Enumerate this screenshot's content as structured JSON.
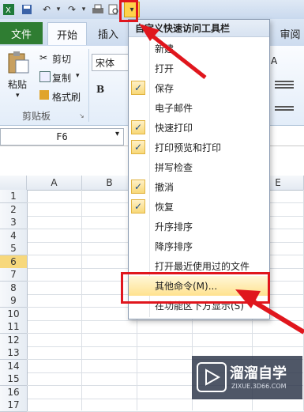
{
  "quick_access": {
    "dropdown_glyph": "▾"
  },
  "tabs": {
    "file": "文件",
    "home": "开始",
    "insert": "插入",
    "review": "审阅"
  },
  "ribbon": {
    "paste": "粘贴",
    "cut": "剪切",
    "copy": "复制",
    "format_painter": "格式刷",
    "clipboard_group": "剪贴板",
    "font_name": "宋体",
    "bold": "B"
  },
  "formula_bar": {
    "name_box": "F6"
  },
  "columns": [
    "A",
    "B",
    "",
    "",
    "E"
  ],
  "rows": [
    "1",
    "2",
    "3",
    "4",
    "5",
    "6",
    "7",
    "8",
    "9",
    "10",
    "11",
    "12",
    "13",
    "14",
    "15",
    "16",
    "17"
  ],
  "selected_row": "6",
  "menu": {
    "title": "自定义快速访问工具栏",
    "items": [
      {
        "label": "新建",
        "checked": false
      },
      {
        "label": "打开",
        "checked": false
      },
      {
        "label": "保存",
        "checked": true
      },
      {
        "label": "电子邮件",
        "checked": false
      },
      {
        "label": "快速打印",
        "checked": true
      },
      {
        "label": "打印预览和打印",
        "checked": true
      },
      {
        "label": "拼写检查",
        "checked": false
      },
      {
        "label": "撤消",
        "checked": true
      },
      {
        "label": "恢复",
        "checked": true
      },
      {
        "label": "升序排序",
        "checked": false
      },
      {
        "label": "降序排序",
        "checked": false
      },
      {
        "label": "打开最近使用过的文件",
        "checked": false
      },
      {
        "label": "其他命令(M)...",
        "checked": false
      },
      {
        "label": "在功能区下方显示(S)",
        "checked": false
      }
    ]
  },
  "watermark": {
    "brand": "溜溜自学",
    "url": "ZIXUE.3D66.COM"
  },
  "colors": {
    "annotation": "#e0161d",
    "file_tab": "#2f7d32",
    "highlight": "#ffe28f"
  }
}
